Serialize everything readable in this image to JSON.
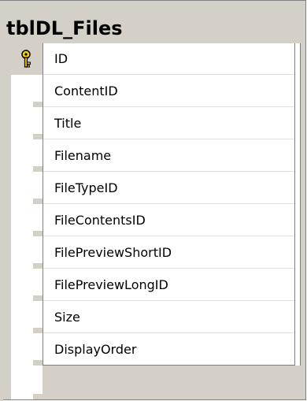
{
  "table": {
    "name": "tblDL_Files",
    "primary_key_icon": "key-icon",
    "columns": [
      {
        "name": "ID",
        "primary_key": true
      },
      {
        "name": "ContentID",
        "primary_key": false
      },
      {
        "name": "Title",
        "primary_key": false
      },
      {
        "name": "Filename",
        "primary_key": false
      },
      {
        "name": "FileTypeID",
        "primary_key": false
      },
      {
        "name": "FileContentsID",
        "primary_key": false
      },
      {
        "name": "FilePreviewShortID",
        "primary_key": false
      },
      {
        "name": "FilePreviewLongID",
        "primary_key": false
      },
      {
        "name": "Size",
        "primary_key": false
      },
      {
        "name": "DisplayOrder",
        "primary_key": false
      }
    ]
  },
  "colors": {
    "background": "#d4d0c8",
    "grid_background": "#ffffff",
    "border": "#808080",
    "key_fill": "#f5d000"
  }
}
